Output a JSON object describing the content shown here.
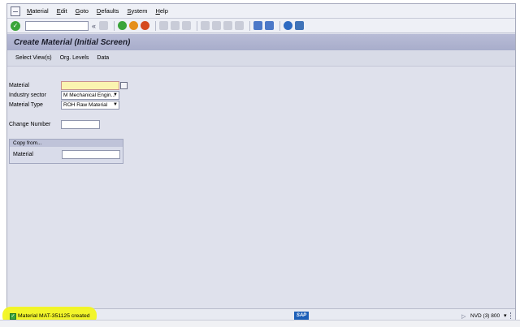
{
  "menubar": {
    "items": [
      "Material",
      "Edit",
      "Goto",
      "Defaults",
      "System",
      "Help"
    ],
    "mnemonics": [
      "M",
      "E",
      "G",
      "D",
      "S",
      "H"
    ]
  },
  "toolbar": {
    "command_field_value": "",
    "back_arrow": "«",
    "icons": [
      "enter-icon",
      "save-icon",
      "back-icon",
      "exit-icon",
      "cancel-icon",
      "print-icon",
      "find-icon",
      "find-next-icon",
      "first-page-icon",
      "prev-page-icon",
      "next-page-icon",
      "last-page-icon",
      "new-session-icon",
      "shortcut-icon",
      "help-icon",
      "customize-icon"
    ]
  },
  "title": "Create Material (Initial Screen)",
  "app_toolbar": {
    "buttons": [
      "Select View(s)",
      "Org. Levels",
      "Data"
    ]
  },
  "form": {
    "material_label": "Material",
    "material_value": "",
    "industry_label": "Industry sector",
    "industry_value": "M Mechanical Engin...",
    "material_type_label": "Material Type",
    "material_type_value": "ROH Raw Material",
    "change_number_label": "Change Number",
    "change_number_value": ""
  },
  "copy_from": {
    "title": "Copy from...",
    "material_label": "Material",
    "material_value": ""
  },
  "statusbar": {
    "message": "Material MAT-351125 created",
    "logo": "SAP",
    "system_info": "NVD (3) 800",
    "highlight_color": "#f2f51f"
  }
}
